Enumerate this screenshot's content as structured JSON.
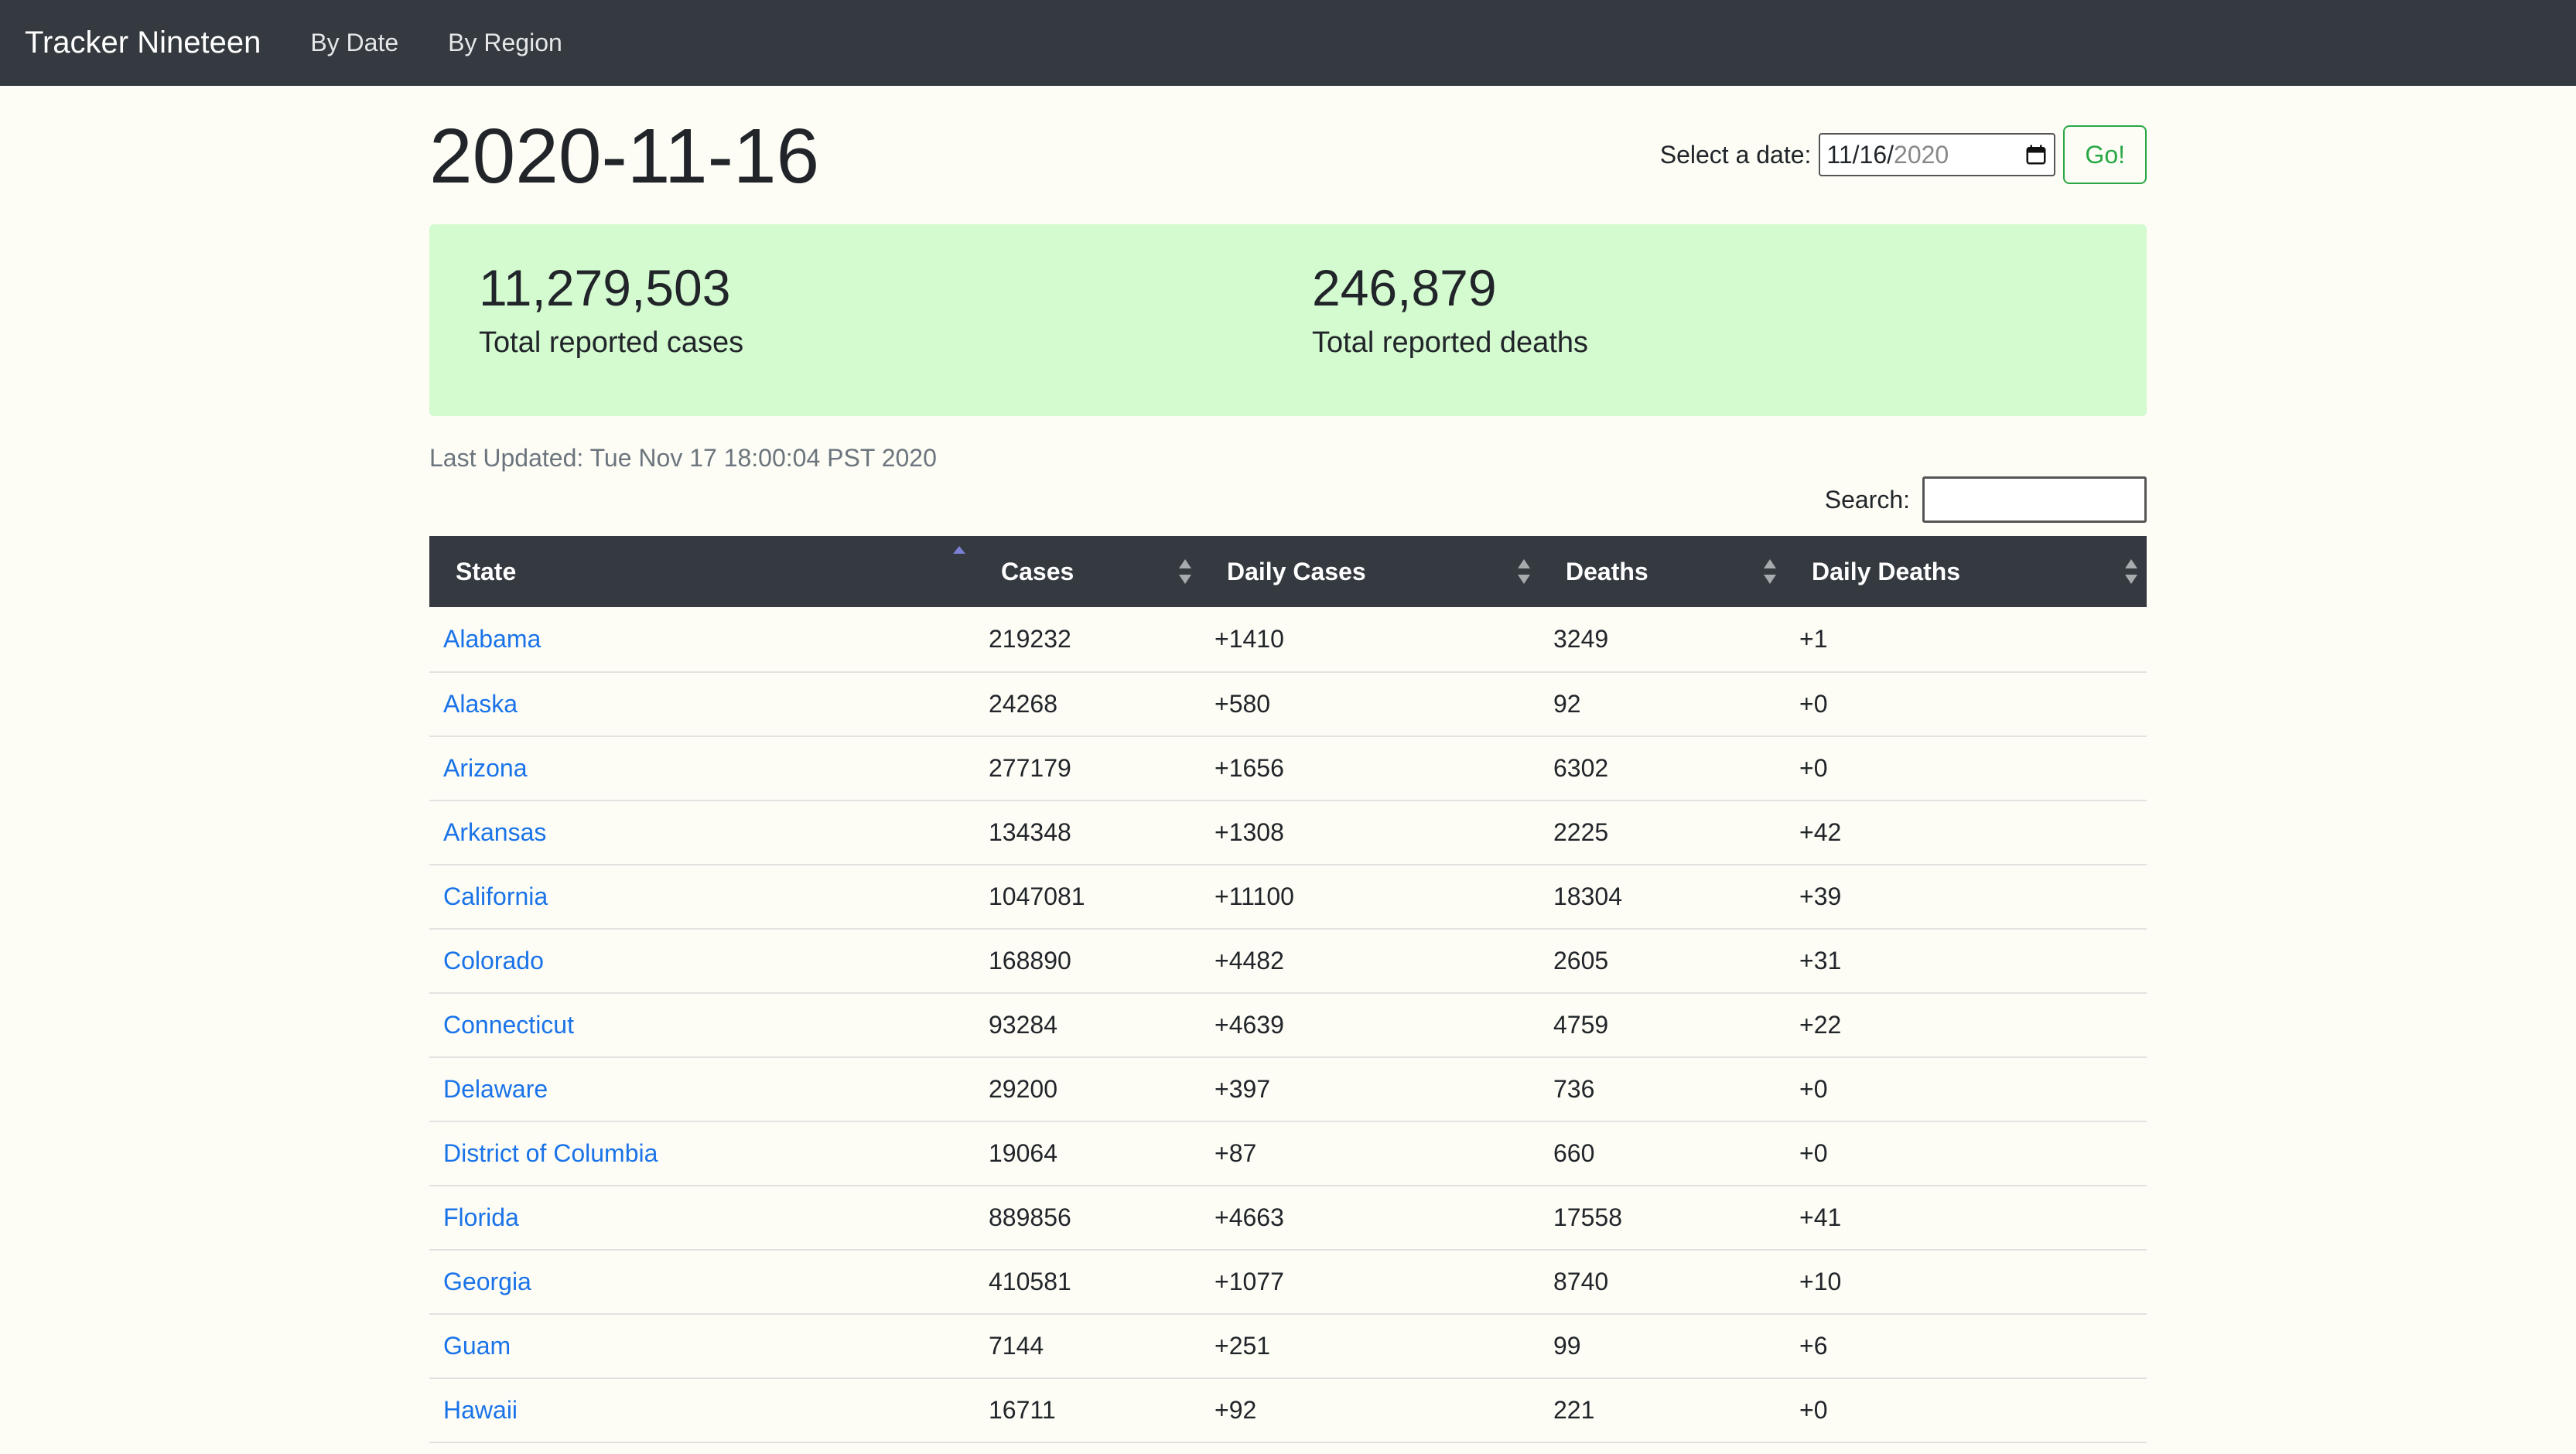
{
  "navbar": {
    "brand": "Tracker Nineteen",
    "links": [
      "By Date",
      "By Region"
    ]
  },
  "page": {
    "title": "2020-11-16"
  },
  "date_form": {
    "label": "Select a date:",
    "value_main": "11/16/",
    "value_year": "2020",
    "go_label": "Go!",
    "accent_color": "#28a745"
  },
  "stats": {
    "cases_value": "11,279,503",
    "cases_label": "Total reported cases",
    "deaths_value": "246,879",
    "deaths_label": "Total reported deaths",
    "background_color": "#d4fad0"
  },
  "last_updated": "Last Updated: Tue Nov 17 18:00:04 PST 2020",
  "search": {
    "label": "Search:",
    "value": ""
  },
  "table": {
    "headers": [
      "State",
      "Cases",
      "Daily Cases",
      "Deaths",
      "Daily Deaths"
    ],
    "sort_icons": [
      "sort-ascending-icon",
      "sort-icon",
      "sort-icon",
      "sort-icon",
      "sort-icon"
    ],
    "rows": [
      [
        "Alabama",
        "219232",
        "+1410",
        "3249",
        "+1"
      ],
      [
        "Alaska",
        "24268",
        "+580",
        "92",
        "+0"
      ],
      [
        "Arizona",
        "277179",
        "+1656",
        "6302",
        "+0"
      ],
      [
        "Arkansas",
        "134348",
        "+1308",
        "2225",
        "+42"
      ],
      [
        "California",
        "1047081",
        "+11100",
        "18304",
        "+39"
      ],
      [
        "Colorado",
        "168890",
        "+4482",
        "2605",
        "+31"
      ],
      [
        "Connecticut",
        "93284",
        "+4639",
        "4759",
        "+22"
      ],
      [
        "Delaware",
        "29200",
        "+397",
        "736",
        "+0"
      ],
      [
        "District of Columbia",
        "19064",
        "+87",
        "660",
        "+0"
      ],
      [
        "Florida",
        "889856",
        "+4663",
        "17558",
        "+41"
      ],
      [
        "Georgia",
        "410581",
        "+1077",
        "8740",
        "+10"
      ],
      [
        "Guam",
        "7144",
        "+251",
        "99",
        "+6"
      ],
      [
        "Hawaii",
        "16711",
        "+92",
        "221",
        "+0"
      ]
    ],
    "link_color": "#1a73e8",
    "header_color": "#343a40"
  }
}
